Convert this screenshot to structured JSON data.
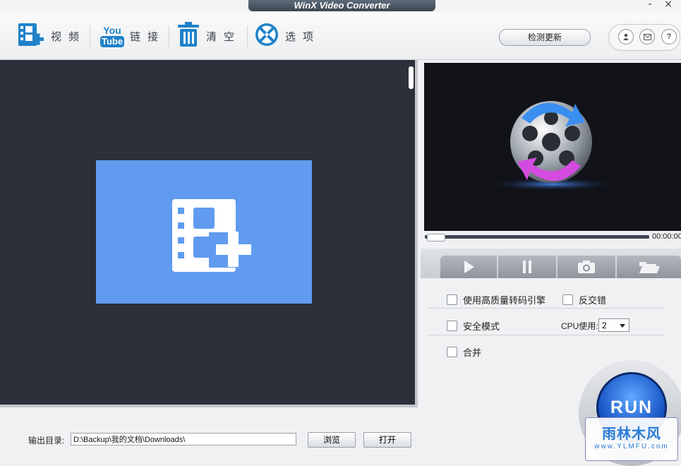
{
  "window": {
    "title": "WinX Video Converter",
    "minimize": "-",
    "close": "×"
  },
  "toolbar": {
    "video_label": "视频",
    "link_label": "链接",
    "clear_label": "清空",
    "options_label": "选项",
    "youtube_top": "You",
    "youtube_bottom": "Tube",
    "update_button": "检测更新",
    "help_glyph": "?"
  },
  "player": {
    "time": "00:00:00",
    "progress": 0
  },
  "options": {
    "hq_engine": {
      "label": "使用高质量转码引擎",
      "checked": false
    },
    "deinterlace": {
      "label": "反交错",
      "checked": false
    },
    "safe_mode": {
      "label": "安全模式",
      "checked": false
    },
    "cpu_label": "CPU使用:",
    "cpu_value": "2",
    "merge": {
      "label": "合并",
      "checked": false
    }
  },
  "output": {
    "label": "输出目录:",
    "path": "D:\\Backup\\我的文档\\Downloads\\",
    "browse_button": "浏览",
    "open_button": "打开"
  },
  "run_button": "RUN",
  "watermark": {
    "main": "雨林木风",
    "sub": "www.YLMFU.com"
  },
  "colors": {
    "dark_panel": "#2d303a",
    "add_tile": "#609bf0",
    "icon_blue": "#1f82c9"
  }
}
